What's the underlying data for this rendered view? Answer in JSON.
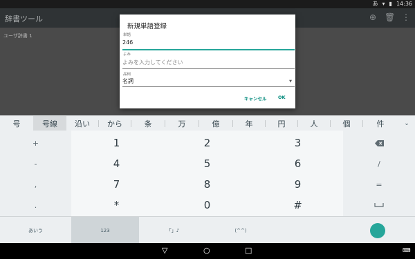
{
  "status_bar": {
    "ime_indicator": "あ",
    "time": "14:36",
    "icons": [
      "wifi-icon",
      "battery-icon"
    ]
  },
  "app_bar": {
    "title": "辞書ツール",
    "actions": [
      "add-icon",
      "delete-icon",
      "more-vert-icon"
    ]
  },
  "content": {
    "dictionary_item": "ユーザ辞書 1"
  },
  "dialog": {
    "title": "新規単語登録",
    "word_caption": "単語",
    "word_value": "246",
    "reading_caption": "よみ",
    "reading_placeholder": "よみを入力してください",
    "pos_caption": "品詞",
    "pos_value": "名詞",
    "cancel_label": "キャンセル",
    "ok_label": "OK"
  },
  "suggestions": [
    "号",
    "号線",
    "沿い",
    "から",
    "条",
    "万",
    "億",
    "年",
    "円",
    "人",
    "個",
    "件"
  ],
  "selected_suggestion": "号線",
  "keyboard": {
    "left_column": [
      "+",
      "-",
      ",",
      "."
    ],
    "num_rows": [
      [
        "1",
        "2",
        "3"
      ],
      [
        "4",
        "5",
        "6"
      ],
      [
        "7",
        "8",
        "9"
      ],
      [
        "*",
        "0",
        "#"
      ]
    ],
    "right_column": [
      "backspace-icon",
      "/",
      "=",
      "space-icon"
    ]
  },
  "bottom_row": {
    "hiragana": "あいう",
    "numeric": "123",
    "symbols": "「」♪",
    "emoticon": "(^^)"
  },
  "colors": {
    "accent": "#26a69a",
    "app_bar": "#2f3335",
    "keyboard_bg": "#eceff1"
  }
}
